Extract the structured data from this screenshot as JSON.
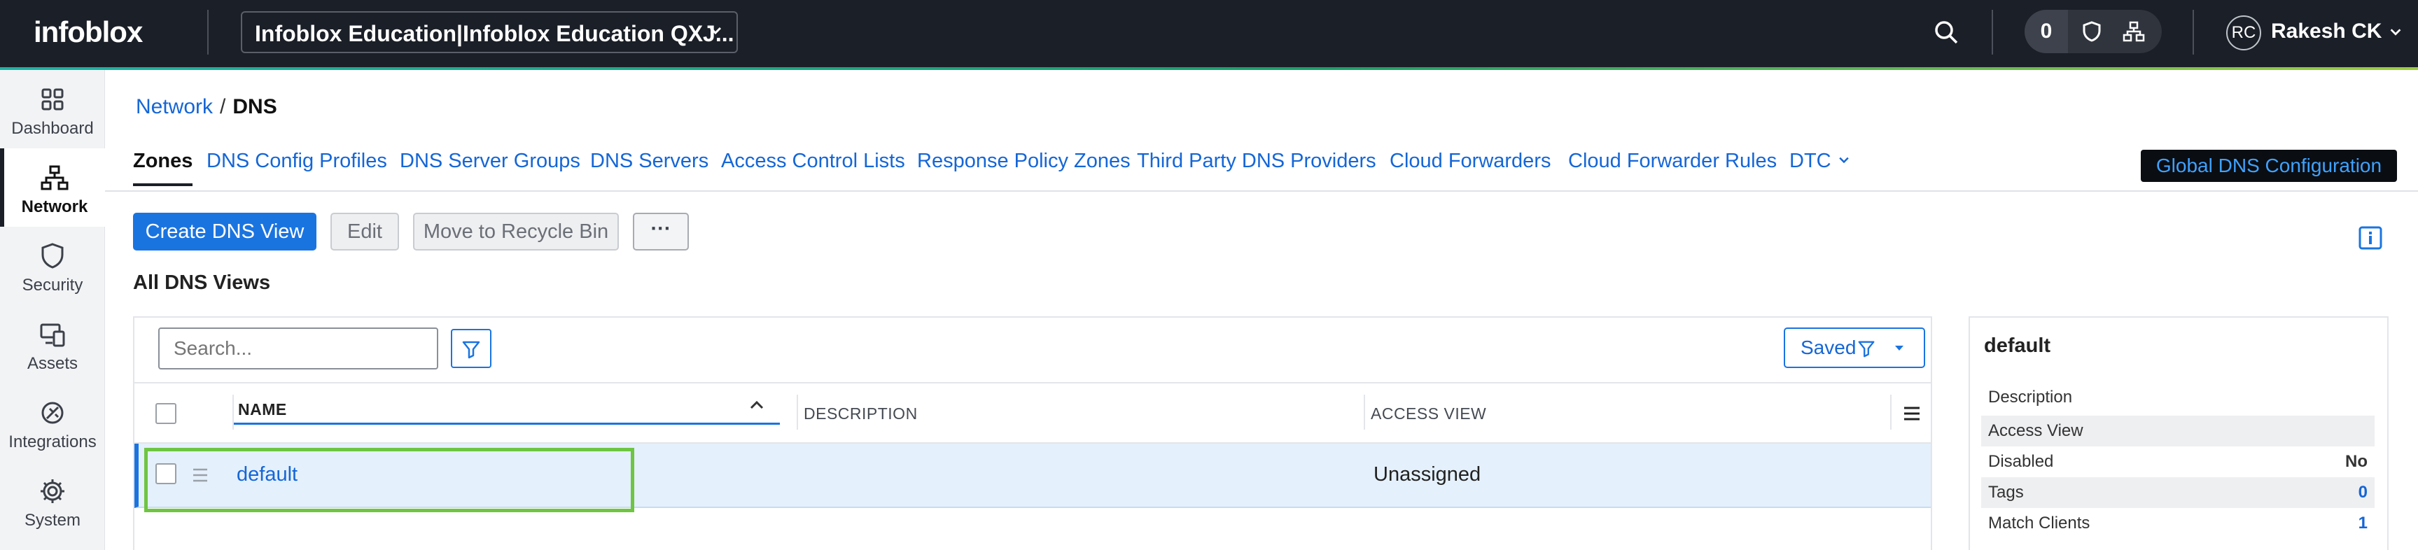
{
  "topbar": {
    "logo": "infoblox",
    "tenant": "Infoblox Education|Infoblox Education QXJ...",
    "notification_count": "0",
    "user_initials": "RC",
    "user_name": "Rakesh CK"
  },
  "leftnav": {
    "items": [
      {
        "label": "Dashboard",
        "icon": "dashboard-icon"
      },
      {
        "label": "Network",
        "icon": "network-icon",
        "active": true
      },
      {
        "label": "Security",
        "icon": "shield-icon"
      },
      {
        "label": "Assets",
        "icon": "assets-icon"
      },
      {
        "label": "Integrations",
        "icon": "integrations-icon"
      },
      {
        "label": "System",
        "icon": "gear-icon"
      }
    ]
  },
  "breadcrumb": {
    "parent": "Network",
    "separator": "/",
    "current": "DNS"
  },
  "tabs": [
    {
      "label": "Zones",
      "active": true
    },
    {
      "label": "DNS Config Profiles"
    },
    {
      "label": "DNS Server Groups"
    },
    {
      "label": "DNS Servers"
    },
    {
      "label": "Access Control Lists"
    },
    {
      "label": "Response Policy Zones"
    },
    {
      "label": "Third Party DNS Providers"
    },
    {
      "label": "Cloud Forwarders"
    },
    {
      "label": "Cloud Forwarder Rules"
    },
    {
      "label": "DTC"
    }
  ],
  "global_button": "Global DNS Configuration",
  "toolbar": {
    "create": "Create DNS View",
    "edit": "Edit",
    "recycle": "Move to Recycle Bin",
    "more": "···"
  },
  "section_title": "All DNS Views",
  "grid": {
    "search_placeholder": "Search...",
    "saved_label": "Saved",
    "columns": [
      "NAME",
      "DESCRIPTION",
      "ACCESS VIEW"
    ],
    "rows": [
      {
        "name": "default",
        "description": "",
        "access_view": "Unassigned"
      }
    ]
  },
  "detail": {
    "title": "default",
    "rows": [
      {
        "label": "Description",
        "value": ""
      },
      {
        "label": "Access View",
        "value": ""
      },
      {
        "label": "Disabled",
        "value": "No"
      },
      {
        "label": "Tags",
        "value": "0"
      },
      {
        "label": "Match Clients",
        "value": "1"
      }
    ]
  },
  "colors": {
    "topbar": "#1b1f27",
    "accent_blue": "#1a74e0",
    "link_blue": "#1566d6",
    "highlight_green": "#6ec542",
    "selected_row": "#e4f0fb"
  }
}
